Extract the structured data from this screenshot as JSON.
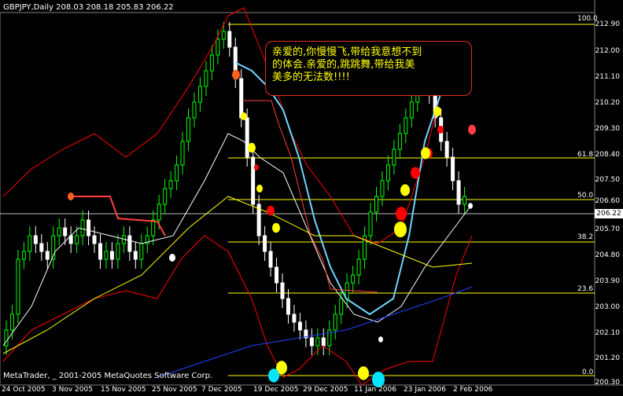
{
  "header": {
    "title": "GBPJPY,Daily  208.03 208.18 205.83 206.22"
  },
  "footer": {
    "copyright": "MetaTrader, _ 2001-2005 MetaQuotes Software Corp."
  },
  "price_axis": {
    "labels": [
      "212.90",
      "212.00",
      "211.10",
      "210.20",
      "209.30",
      "208.40",
      "207.50",
      "206.60",
      "205.70",
      "204.80",
      "203.90",
      "203.00",
      "202.10",
      "201.20",
      "200.30"
    ],
    "current": "206.22"
  },
  "time_axis": {
    "labels": [
      "24 Oct 2005",
      "3 Nov 2005",
      "15 Nov 2005",
      "25 Nov 2005",
      "7 Dec 2005",
      "19 Dec 2005",
      "29 Dec 2005",
      "11 Jan 2006",
      "23 Jan 2006",
      "2 Feb 2006"
    ]
  },
  "fibonacci": {
    "levels": [
      "100.0",
      "61.8",
      "50.0",
      "38.2",
      "23.6",
      "0.0"
    ]
  },
  "annotation": {
    "lines": [
      "亲爱的,你慢慢飞,带给我意想不到",
      "的体会.亲爱的,跳跳舞,带给我美",
      "美多的无法数!!!!"
    ]
  },
  "colors": {
    "background": "#000000",
    "bull_candle": "#00ff00",
    "bear_candle": "#ffffff",
    "bollinger": "#ff0000",
    "ma_cyan": "#6fd6ff",
    "ma_white": "#ffffff",
    "ma_yellow": "#ffff00",
    "ma_blue": "#2040ff",
    "fib_line": "#ffff00"
  }
}
